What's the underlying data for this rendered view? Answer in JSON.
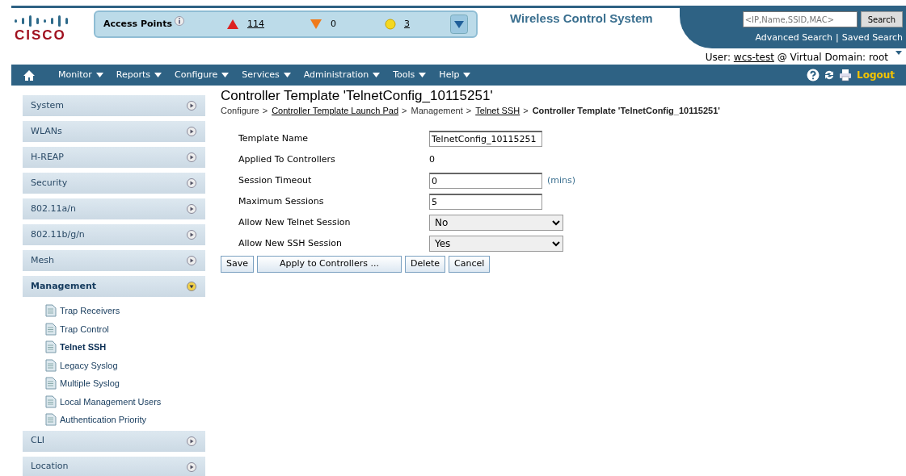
{
  "header": {
    "logo_text": "CISCO",
    "app_title": "Wireless Control System"
  },
  "alarm_bar": {
    "title": "Access Points",
    "counts": [
      {
        "kind": "critical",
        "value": "114",
        "link": true
      },
      {
        "kind": "major",
        "value": "0",
        "link": false
      },
      {
        "kind": "minor",
        "value": "3",
        "link": true
      }
    ]
  },
  "search": {
    "placeholder": "<IP,Name,SSID,MAC>",
    "button": "Search",
    "links": [
      "Advanced Search",
      "Saved Search"
    ],
    "separator": "|"
  },
  "user": {
    "label": "User:",
    "name": "wcs-test",
    "domain_label": "@ Virtual Domain:",
    "domain": "root"
  },
  "menu": [
    "Monitor",
    "Reports",
    "Configure",
    "Services",
    "Administration",
    "Tools",
    "Help"
  ],
  "logout": "Logout",
  "sidebar": [
    {
      "label": "System",
      "expanded": false
    },
    {
      "label": "WLANs",
      "expanded": false
    },
    {
      "label": "H-REAP",
      "expanded": false
    },
    {
      "label": "Security",
      "expanded": false
    },
    {
      "label": "802.11a/n",
      "expanded": false
    },
    {
      "label": "802.11b/g/n",
      "expanded": false
    },
    {
      "label": "Mesh",
      "expanded": false
    },
    {
      "label": "Management",
      "expanded": true,
      "children": [
        {
          "label": "Trap Receivers",
          "selected": false
        },
        {
          "label": "Trap Control",
          "selected": false
        },
        {
          "label": "Telnet SSH",
          "selected": true
        },
        {
          "label": "Legacy Syslog",
          "selected": false
        },
        {
          "label": "Multiple Syslog",
          "selected": false
        },
        {
          "label": "Local Management Users",
          "selected": false
        },
        {
          "label": "Authentication Priority",
          "selected": false
        }
      ]
    },
    {
      "label": "CLI",
      "expanded": false
    },
    {
      "label": "Location",
      "expanded": false
    }
  ],
  "page_title": "Controller Template 'TelnetConfig_10115251'",
  "breadcrumb": [
    {
      "text": "Configure",
      "link": false
    },
    {
      "separator": ">",
      "text": "Controller Template Launch Pad",
      "link": true
    },
    {
      "separator": ">",
      "text": "Management",
      "link": false
    },
    {
      "separator": ">",
      "text": "Telnet SSH",
      "link": true
    },
    {
      "separator": ">",
      "text": "Controller Template 'TelnetConfig_10115251'",
      "link": false,
      "current": true
    }
  ],
  "form": [
    {
      "kind": "input",
      "label": "Template Name",
      "value": "TelnetConfig_10115251"
    },
    {
      "kind": "text",
      "label": "Applied To Controllers",
      "value": "0"
    },
    {
      "kind": "input",
      "label": "Session Timeout",
      "value": "0",
      "unit": "(mins)"
    },
    {
      "kind": "input",
      "label": "Maximum Sessions",
      "value": "5"
    },
    {
      "kind": "select",
      "label": "Allow New Telnet Session",
      "value": "No"
    },
    {
      "kind": "select",
      "label": "Allow New SSH Session",
      "value": "Yes"
    }
  ],
  "buttons": [
    "Save",
    "Apply to Controllers ...",
    "Delete",
    "Cancel"
  ]
}
